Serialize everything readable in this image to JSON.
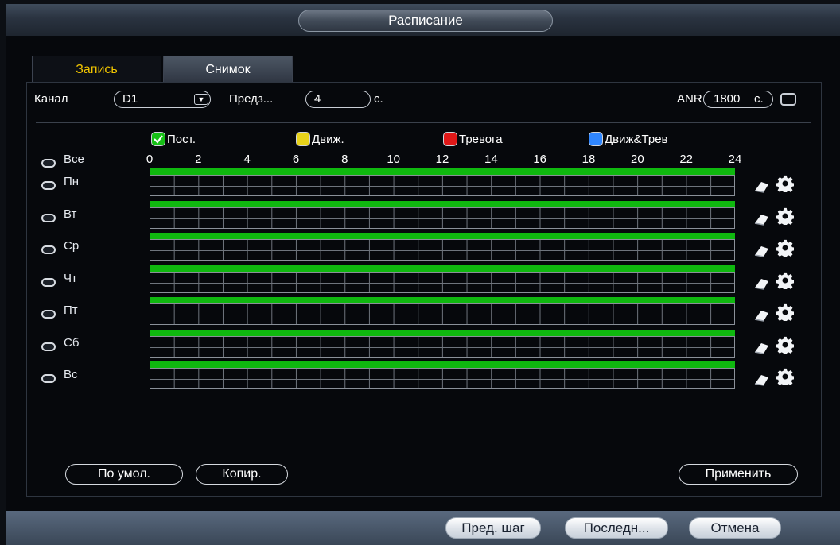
{
  "window": {
    "title": "Расписание"
  },
  "tabs": [
    {
      "label": "Запись",
      "active": true
    },
    {
      "label": "Снимок",
      "active": false
    }
  ],
  "controls": {
    "channel_label": "Канал",
    "channel_value": "D1",
    "prerecord_label": "Предз...",
    "prerecord_value": "4",
    "prerecord_unit": "с.",
    "anr_label": "ANR",
    "anr_value": "1800",
    "anr_unit": "с.",
    "anr_checked": false
  },
  "legend": [
    {
      "label": "Пост.",
      "color": "#16c016",
      "checked": true
    },
    {
      "label": "Движ.",
      "color": "#e7d21a",
      "checked": false
    },
    {
      "label": "Тревога",
      "color": "#e01818",
      "checked": false
    },
    {
      "label": "Движ&Трев",
      "color": "#2f86ff",
      "checked": false
    }
  ],
  "all_label": "Все",
  "hours": [
    "0",
    "2",
    "4",
    "6",
    "8",
    "10",
    "12",
    "14",
    "16",
    "18",
    "20",
    "22",
    "24"
  ],
  "days": [
    {
      "label": "Пн",
      "record_from": 0,
      "record_to": 24
    },
    {
      "label": "Вт",
      "record_from": 0,
      "record_to": 24
    },
    {
      "label": "Ср",
      "record_from": 0,
      "record_to": 24
    },
    {
      "label": "Чт",
      "record_from": 0,
      "record_to": 24
    },
    {
      "label": "Пт",
      "record_from": 0,
      "record_to": 24
    },
    {
      "label": "Сб",
      "record_from": 0,
      "record_to": 24
    },
    {
      "label": "Вс",
      "record_from": 0,
      "record_to": 24
    }
  ],
  "buttons": {
    "default": "По умол.",
    "copy": "Копир.",
    "apply": "Применить",
    "prev": "Пред. шаг",
    "last": "Последн...",
    "cancel": "Отмена"
  },
  "colors": {
    "record_bar": "#0fb80f",
    "active_tab_text": "#f0c400"
  }
}
